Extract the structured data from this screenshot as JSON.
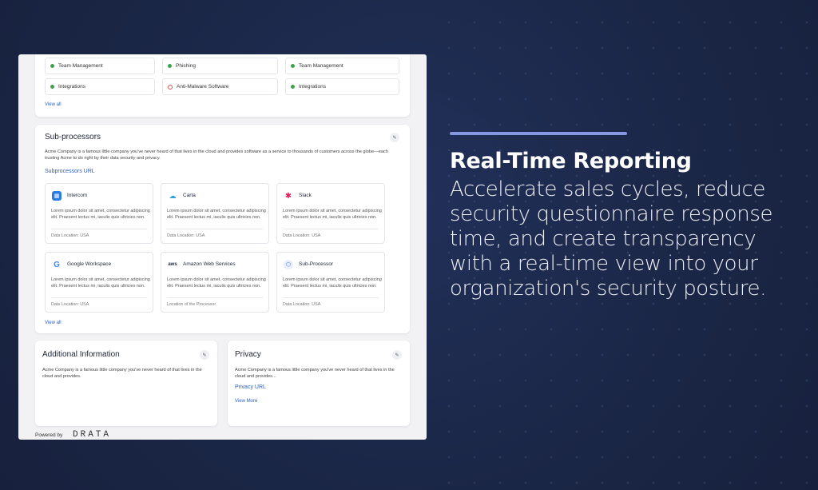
{
  "top_card": {
    "pills": [
      {
        "label": "Team Management",
        "status": "ok"
      },
      {
        "label": "Phishing",
        "status": "ok"
      },
      {
        "label": "Team Management",
        "status": "ok"
      },
      {
        "label": "Integrations",
        "status": "ok"
      },
      {
        "label": "Anti-Malware Software",
        "status": "fail"
      },
      {
        "label": "Integrations",
        "status": "ok"
      }
    ],
    "view_all": "View all"
  },
  "subprocessors": {
    "title": "Sub-processors",
    "description": "Acme Company is a famous little company you've never heard of that lives in the cloud and provides software as a service to thousands of customers across the globe—each trusting Acme to do right by their data security and privacy.",
    "url_label": "Subprocessors URL",
    "vendors": [
      {
        "name": "Intercom",
        "icon": "intercom-icon",
        "body": "Lorem ipsum dolor sit amet, consectetur adipiscing elit. Praesent lectus mi, iaculis quis ultricies non.",
        "location": "Data Location: USA"
      },
      {
        "name": "Carta",
        "icon": "carta-icon",
        "body": "Lorem ipsum dolor sit amet, consectetur adipiscing elit. Praesent lectus mi, iaculis quis ultricies non.",
        "location": "Data Location: USA"
      },
      {
        "name": "Slack",
        "icon": "slack-icon",
        "body": "Lorem ipsum dolor sit amet, consectetur adipiscing elit. Praesent lectus mi, iaculis quis ultricies non.",
        "location": "Data Location: USA"
      },
      {
        "name": "Google Workspace",
        "icon": "google-icon",
        "body": "Lorem ipsum dolor sit amet, consectetur adipiscing elit. Praesent lectus mi, iaculis quis ultricies non.",
        "location": "Data Location: USA"
      },
      {
        "name": "Amazon Web Services",
        "icon": "aws-icon",
        "body": "Lorem ipsum dolor sit amet, consectetur adipiscing elit. Praesent lectus mi, iaculis quis ultricies non.",
        "location": "Location of the Processor"
      },
      {
        "name": "Sub-Processor",
        "icon": "sub-processor-icon",
        "body": "Lorem ipsum dolor sit amet, consectetur adipiscing elit. Praesent lectus mi, iaculis quis ultricies non.",
        "location": "Data Location: USA"
      }
    ],
    "view_all": "View all"
  },
  "additional": {
    "title": "Additional Information",
    "description": "Acme Company is a famous little company you've never heard of that lives in the cloud and provides."
  },
  "privacy": {
    "title": "Privacy",
    "description": "Acme Company is a famous little company you've never heard of that lives in the cloud and provides...",
    "url_label": "Privacy URL",
    "view_more": "View More"
  },
  "footer": {
    "powered_by": "Powered by",
    "brand": "DRATA"
  },
  "marketing": {
    "heading": "Real-Time Reporting",
    "body": "Accelerate sales cycles, reduce security questionnaire response time, and create transparency with a real-time view into your organization's security posture."
  },
  "colors": {
    "background": "#1b2747",
    "accent": "#8597e0",
    "link": "#2a62c4",
    "ok": "#3fa34d",
    "fail": "#d9534f"
  }
}
